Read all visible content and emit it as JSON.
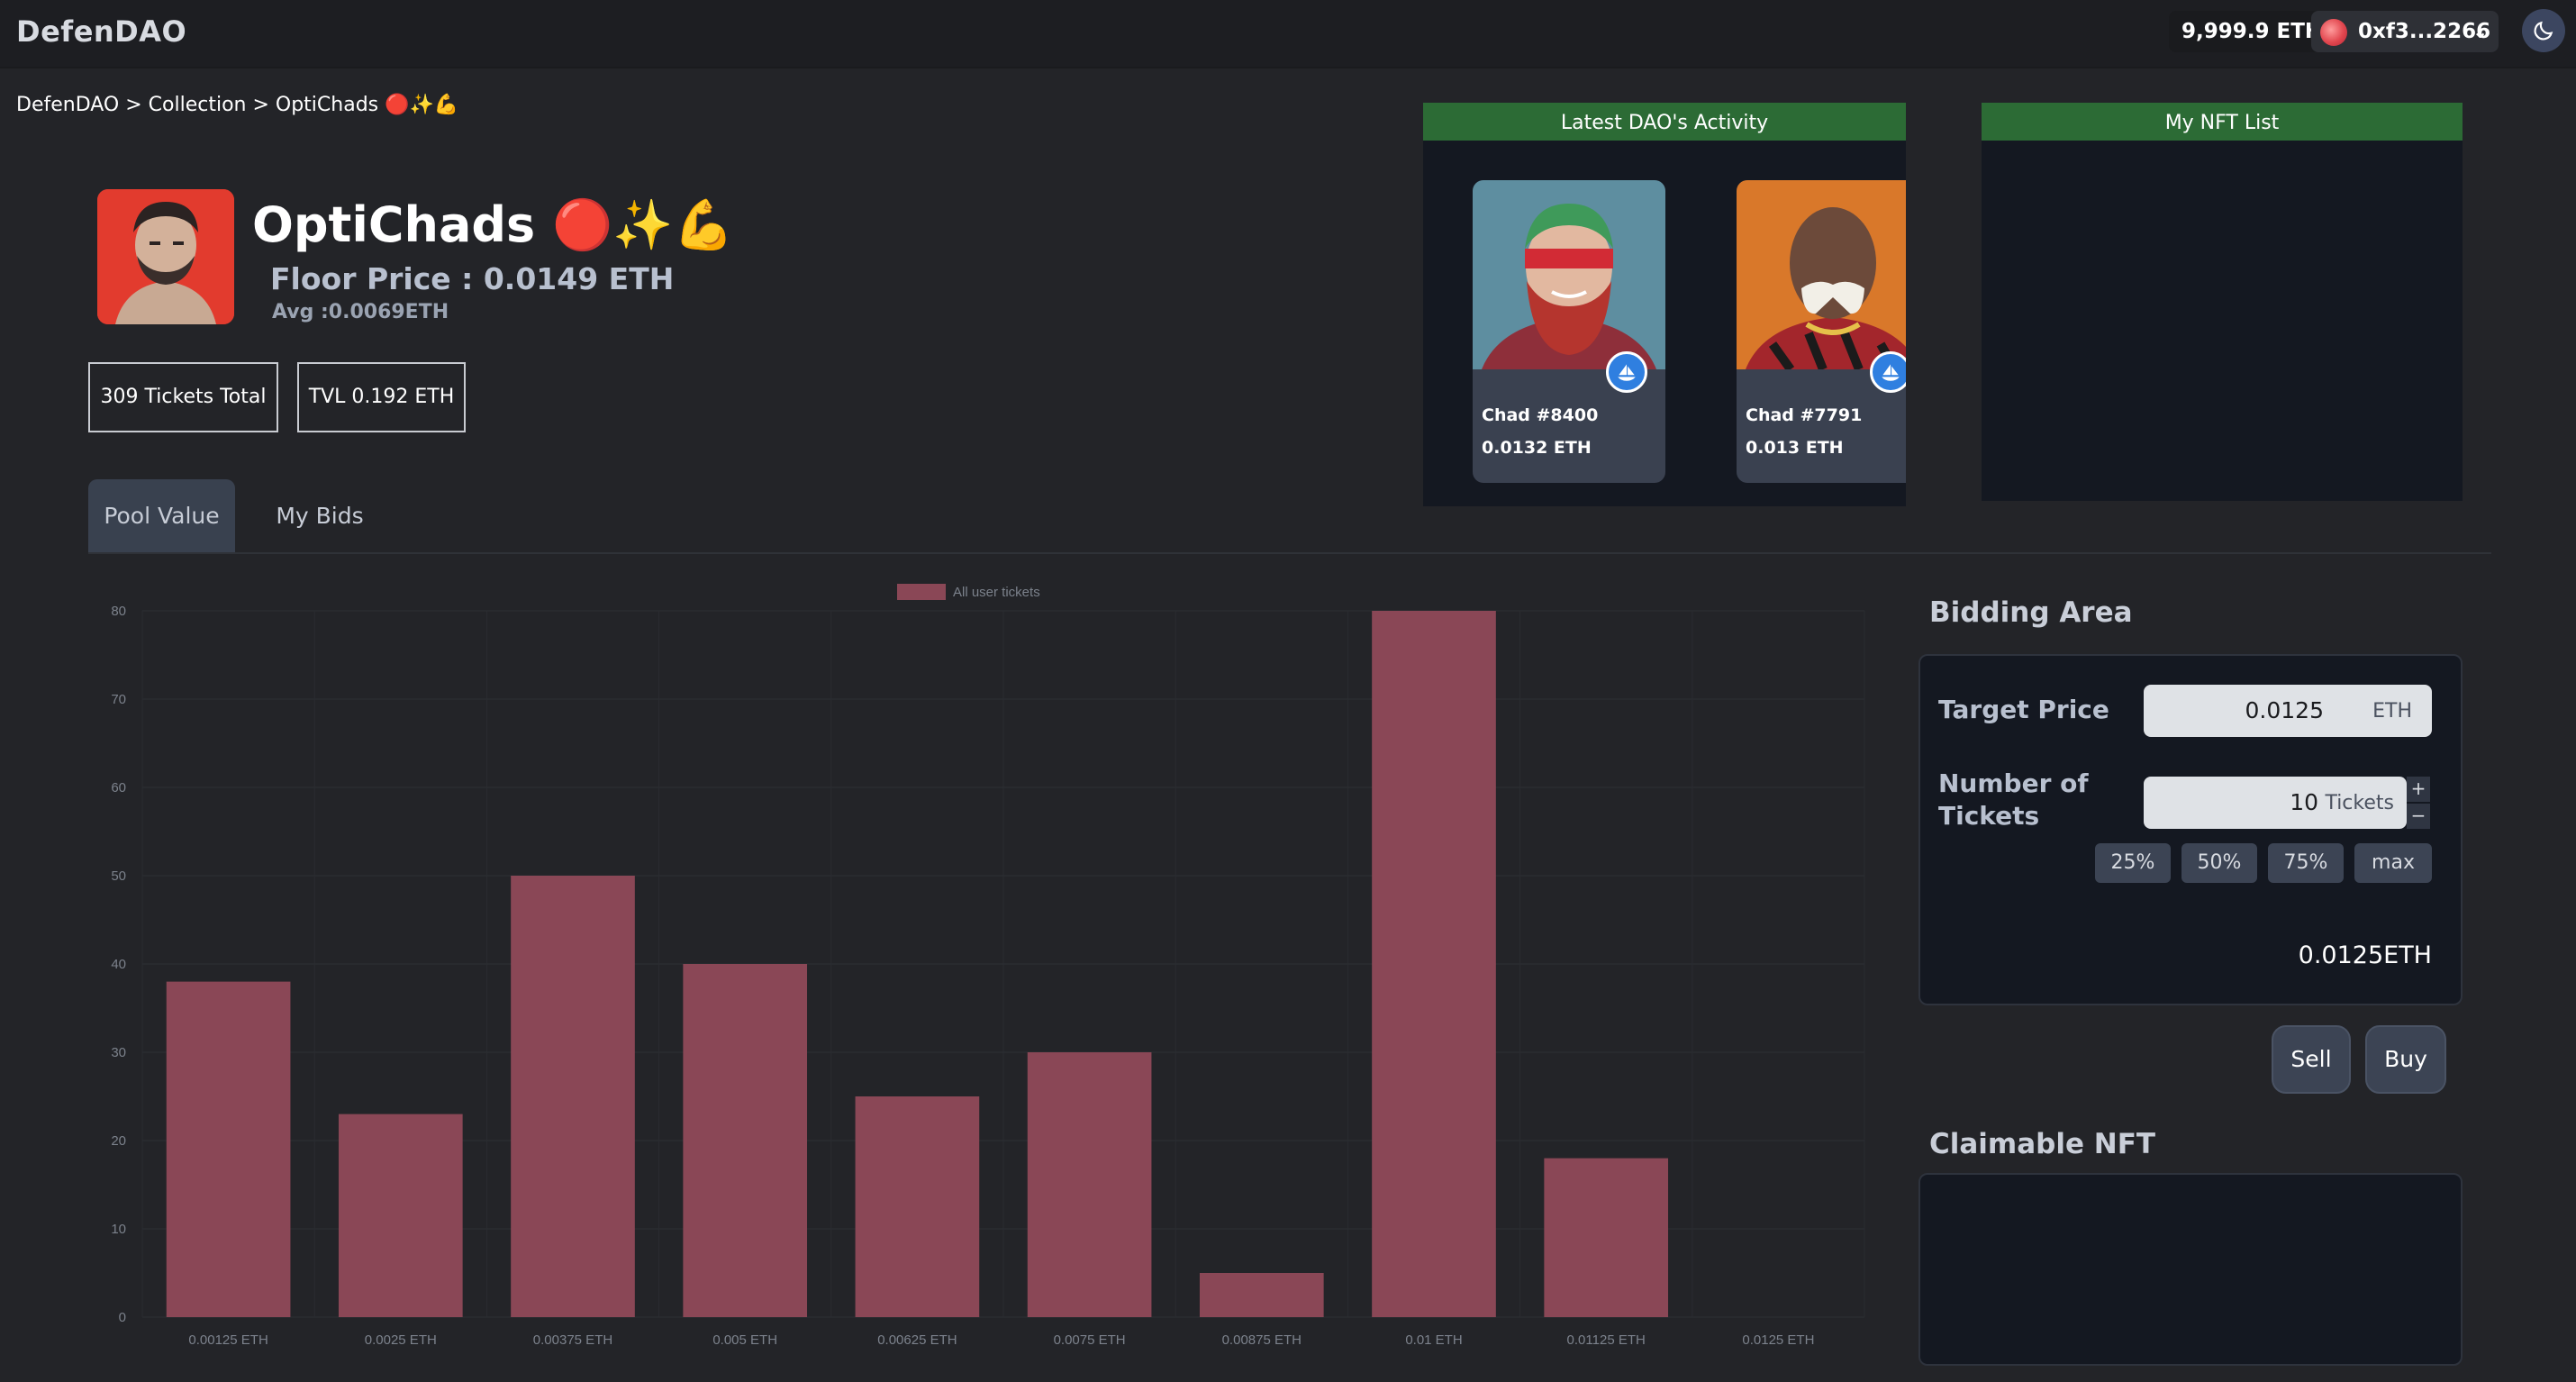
{
  "header": {
    "brand": "DefenDAO",
    "balance": "9,999.9 ETH",
    "account": "0xf3...2266",
    "theme_icon": "moon-icon"
  },
  "breadcrumb": "DefenDAO > Collection > OptiChads 🔴✨💪",
  "collection": {
    "name": "OptiChads 🔴✨💪",
    "floor_price": "Floor Price : 0.0149 ETH",
    "avg": "Avg :0.0069ETH",
    "tickets_total": "309 Tickets Total",
    "tvl": "TVL 0.192 ETH"
  },
  "tabs": [
    {
      "label": "Pool Value",
      "active": true
    },
    {
      "label": "My Bids",
      "active": false
    }
  ],
  "activity": {
    "title": "Latest DAO's Activity",
    "cards": [
      {
        "name": "Chad #8400",
        "price": "0.0132 ETH"
      },
      {
        "name": "Chad #7791",
        "price": "0.013 ETH"
      }
    ]
  },
  "nft_list": {
    "title": "My NFT List"
  },
  "bidding": {
    "title": "Bidding Area",
    "target_label": "Target Price",
    "target_value": "0.0125",
    "target_unit": "ETH",
    "tickets_label_1": "Number of",
    "tickets_label_2": "Tickets",
    "tickets_value": "10",
    "tickets_unit": "Tickets",
    "plus": "+",
    "minus": "−",
    "percent_buttons": [
      "25%",
      "50%",
      "75%",
      "max"
    ],
    "total": "0.0125ETH",
    "sell": "Sell",
    "buy": "Buy"
  },
  "claimable": {
    "title": "Claimable NFT"
  },
  "colors": {
    "bar": "#8a4756",
    "panel_header": "#2c6b35"
  },
  "chart_data": {
    "type": "bar",
    "categories": [
      "0.00125 ETH",
      "0.0025 ETH",
      "0.00375 ETH",
      "0.005 ETH",
      "0.00625 ETH",
      "0.0075 ETH",
      "0.00875 ETH",
      "0.01 ETH",
      "0.01125 ETH",
      "0.0125 ETH"
    ],
    "series": [
      {
        "name": "All user tickets",
        "values": [
          38,
          23,
          50,
          40,
          25,
          30,
          5,
          80,
          18,
          0
        ]
      }
    ],
    "yticks": [
      "0",
      "10",
      "20",
      "30",
      "40",
      "50",
      "60",
      "70",
      "80"
    ],
    "ylim": [
      0,
      80
    ],
    "grid": true,
    "legend": "top-center"
  }
}
